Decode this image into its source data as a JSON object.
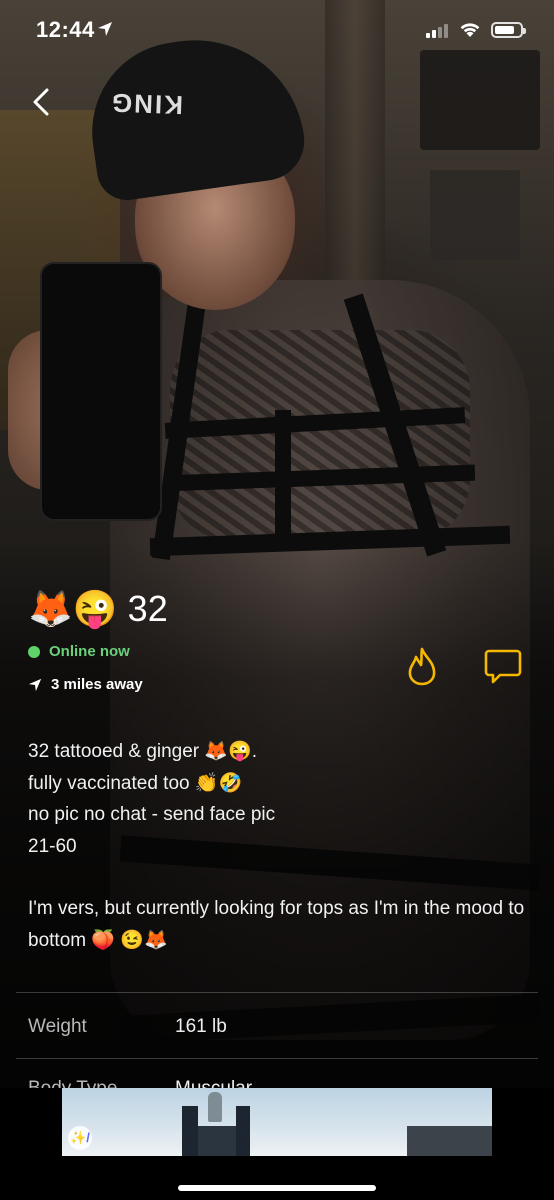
{
  "status_bar": {
    "time": "12:44",
    "battery_level": 0.8
  },
  "profile": {
    "display_name": "🦊😜",
    "age": "32",
    "online_status": "Online now",
    "distance": "3 miles away",
    "bio_lines": [
      "32  tattooed & ginger 🦊😜.",
      "fully vaccinated too 👏🤣",
      "no pic no chat - send face pic",
      "21-60"
    ],
    "bio_paragraph_2": "I'm vers, but currently looking for tops as I'm in the mood to bottom 🍑 😉🦊",
    "stats": [
      {
        "label": "Weight",
        "value": "161 lb"
      },
      {
        "label": "Body Type",
        "value": "Muscular"
      }
    ]
  },
  "colors": {
    "online_green": "#5fd36a",
    "accent_yellow": "#f5b800"
  },
  "ad": {
    "badge_text": "✨/"
  }
}
